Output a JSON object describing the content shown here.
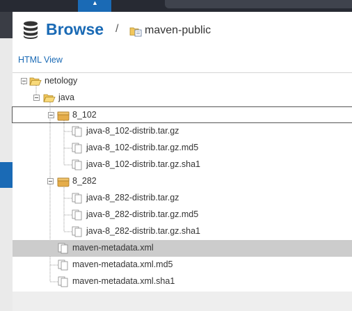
{
  "header": {
    "title": "Browse",
    "separator": "/",
    "repository": "maven-public"
  },
  "content": {
    "html_view_link": "HTML View"
  },
  "tree": [
    {
      "label": "netology",
      "type": "folder-open"
    },
    {
      "label": "java",
      "type": "folder-open"
    },
    {
      "label": "8_102",
      "type": "package"
    },
    {
      "label": "java-8_102-distrib.tar.gz",
      "type": "file"
    },
    {
      "label": "java-8_102-distrib.tar.gz.md5",
      "type": "file"
    },
    {
      "label": "java-8_102-distrib.tar.gz.sha1",
      "type": "file"
    },
    {
      "label": "8_282",
      "type": "package"
    },
    {
      "label": "java-8_282-distrib.tar.gz",
      "type": "file"
    },
    {
      "label": "java-8_282-distrib.tar.gz.md5",
      "type": "file"
    },
    {
      "label": "java-8_282-distrib.tar.gz.sha1",
      "type": "file"
    },
    {
      "label": "maven-metadata.xml",
      "type": "file"
    },
    {
      "label": "maven-metadata.xml.md5",
      "type": "file"
    },
    {
      "label": "maven-metadata.xml.sha1",
      "type": "file"
    }
  ],
  "colors": {
    "accent": "#1a6ab5",
    "topbar": "#272a33",
    "selected_row": "#cccccc"
  }
}
